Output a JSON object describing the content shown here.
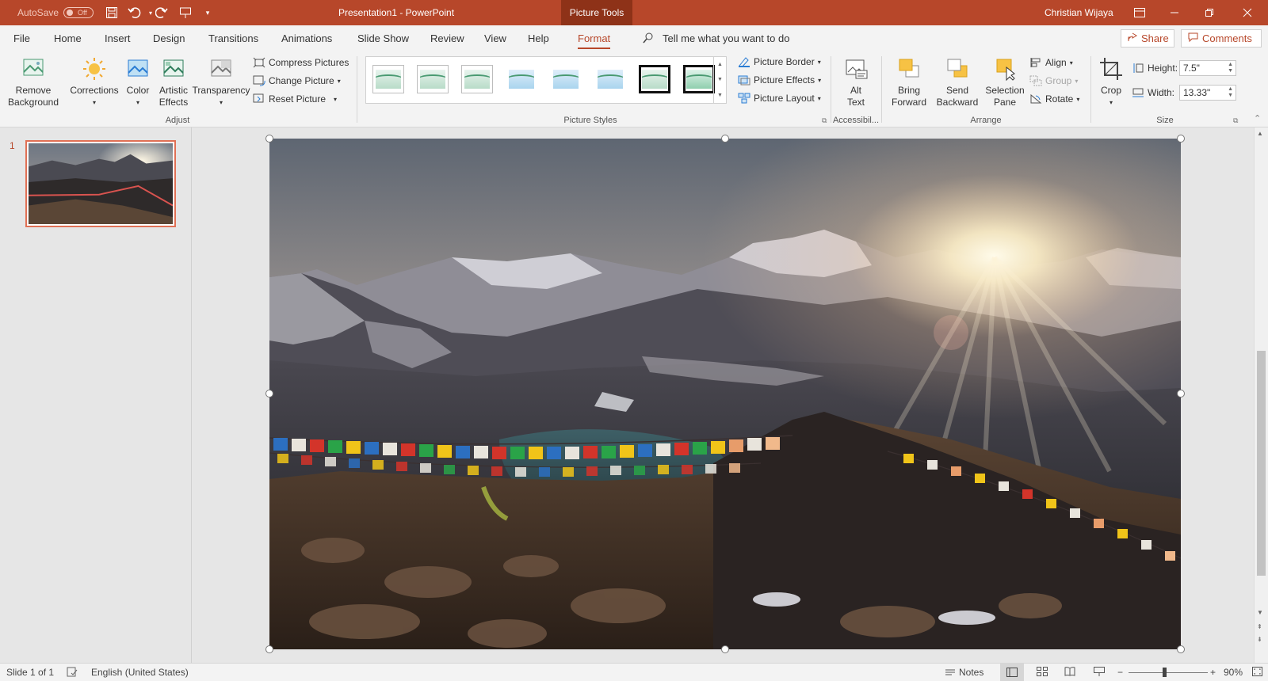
{
  "titlebar": {
    "autosave_label": "AutoSave",
    "autosave_state": "Off",
    "document_title": "Presentation1  -  PowerPoint",
    "contextual_tab": "Picture Tools",
    "user_name": "Christian Wijaya",
    "accent_color": "#b7472a"
  },
  "tabs": [
    "File",
    "Home",
    "Insert",
    "Design",
    "Transitions",
    "Animations",
    "Slide Show",
    "Review",
    "View",
    "Help",
    "Format"
  ],
  "tell_me": "Tell me what you want to do",
  "share_label": "Share",
  "comments_label": "Comments",
  "ribbon": {
    "adjust": {
      "remove_background": [
        "Remove",
        "Background"
      ],
      "corrections": "Corrections",
      "color": "Color",
      "artistic_effects": [
        "Artistic",
        "Effects"
      ],
      "transparency": "Transparency",
      "compress_pictures": "Compress Pictures",
      "change_picture": "Change Picture",
      "reset_picture": "Reset Picture",
      "group_label": "Adjust"
    },
    "picture_styles": {
      "picture_border": "Picture Border",
      "picture_effects": "Picture Effects",
      "picture_layout": "Picture Layout",
      "group_label": "Picture Styles"
    },
    "accessibility": {
      "alt_text": [
        "Alt",
        "Text"
      ],
      "group_label": "Accessibil..."
    },
    "arrange": {
      "bring_forward": [
        "Bring",
        "Forward"
      ],
      "send_backward": [
        "Send",
        "Backward"
      ],
      "selection_pane": [
        "Selection",
        "Pane"
      ],
      "align": "Align",
      "group": "Group",
      "rotate": "Rotate",
      "group_label": "Arrange"
    },
    "size": {
      "crop": "Crop",
      "height_label": "Height:",
      "height_value": "7.5\"",
      "width_label": "Width:",
      "width_value": "13.33\"",
      "group_label": "Size"
    }
  },
  "slides": {
    "current_number": "1"
  },
  "statusbar": {
    "slide_info": "Slide 1 of 1",
    "language": "English (United States)",
    "notes": "Notes",
    "zoom": "90%"
  }
}
